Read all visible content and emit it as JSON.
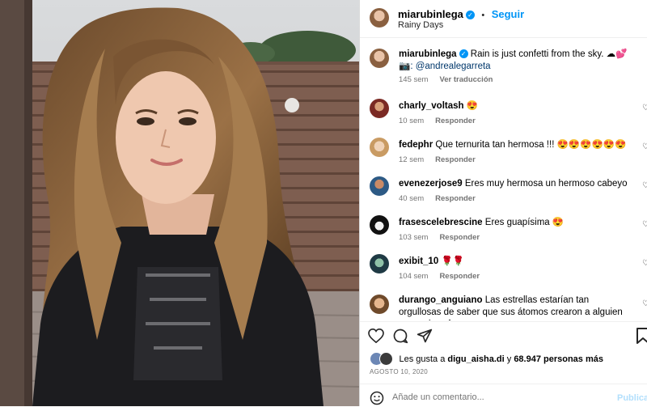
{
  "post": {
    "author": "miarubinlega",
    "follow_label": "Seguir",
    "separator": "•",
    "location": "Rainy Days",
    "caption_user": "miarubinlega",
    "caption_text": "Rain is just confetti from the sky. ☁💕",
    "caption_credit": "📷: @andrealegarreta",
    "caption_time": "145 sem",
    "translate_label": "Ver traducción"
  },
  "comments": [
    {
      "user": "charly_voltash",
      "text": "😍",
      "time": "10 sem",
      "reply": "Responder"
    },
    {
      "user": "fedephr",
      "text": "Que ternurita tan hermosa !!! 😍😍😍😍😍😍",
      "time": "12 sem",
      "reply": "Responder"
    },
    {
      "user": "evenezerjose9",
      "text": "Eres muy hermosa un hermoso cabeyo",
      "time": "40 sem",
      "reply": "Responder"
    },
    {
      "user": "frasescelebrescine",
      "text": "Eres guapísima 😍",
      "time": "103 sem",
      "reply": "Responder"
    },
    {
      "user": "exibit_10",
      "text": "🌹🌹",
      "time": "104 sem",
      "reply": "Responder"
    },
    {
      "user": "durango_anguiano",
      "text": "Las estrellas estarían tan orgullosas de saber que sus átomos crearon a alguien como tú perfecta en",
      "time": "",
      "reply": ""
    }
  ],
  "likes": {
    "prefix": "Les gusta a",
    "user": "digu_aisha.di",
    "and": "y",
    "count": "68.947 personas más"
  },
  "date": "AGOSTO 10, 2020",
  "add_comment": {
    "placeholder": "Añade un comentario...",
    "publish": "Publicar"
  },
  "icons": {
    "verified": "verified-badge-icon",
    "like": "heart-icon",
    "comment": "comment-icon",
    "share": "send-icon",
    "save": "bookmark-icon",
    "emoji": "emoji-icon"
  },
  "colors": {
    "accent": "#0095f6",
    "text": "#262626",
    "muted": "#737373",
    "border": "#dbdbdb"
  }
}
